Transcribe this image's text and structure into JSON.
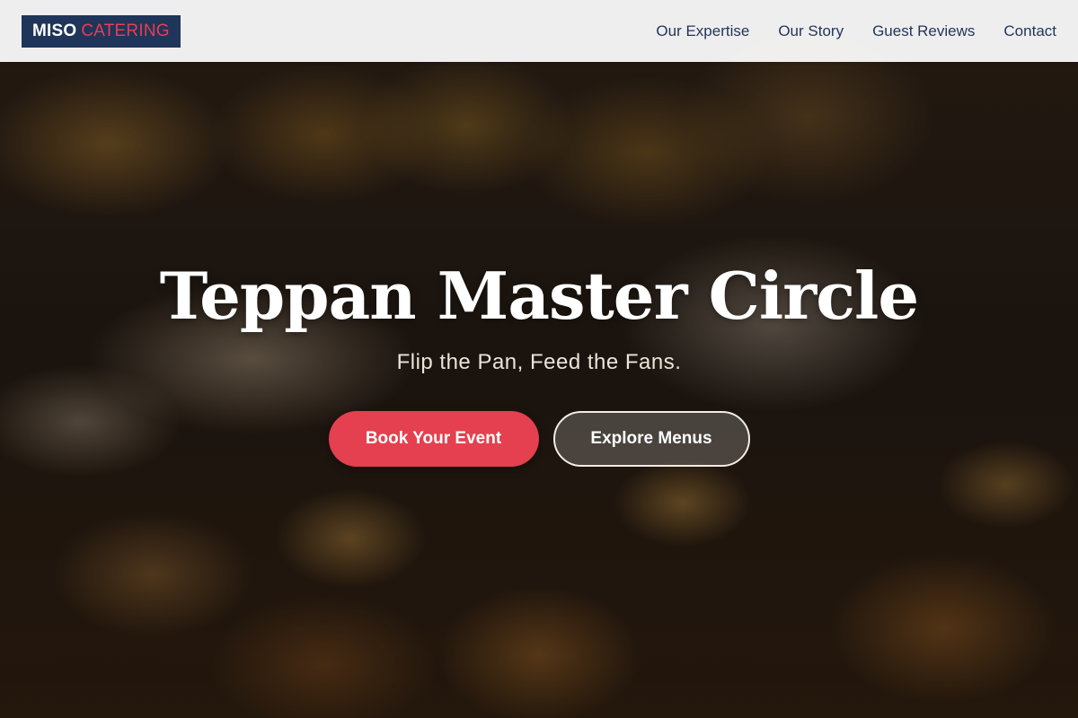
{
  "brand": {
    "logo_primary": "MISO",
    "logo_accent": "CATERING",
    "primary_color": "#1f3559",
    "accent_color": "#e63e54"
  },
  "nav": {
    "links": [
      {
        "label": "Our Expertise"
      },
      {
        "label": "Our Story"
      },
      {
        "label": "Guest Reviews"
      },
      {
        "label": "Contact"
      }
    ]
  },
  "hero": {
    "title": "Teppan Master Circle",
    "subtitle": "Flip the Pan, Feed the Fans.",
    "primary_cta": "Book Your Event",
    "secondary_cta": "Explore Menus",
    "cta_color": "#e4404f"
  }
}
